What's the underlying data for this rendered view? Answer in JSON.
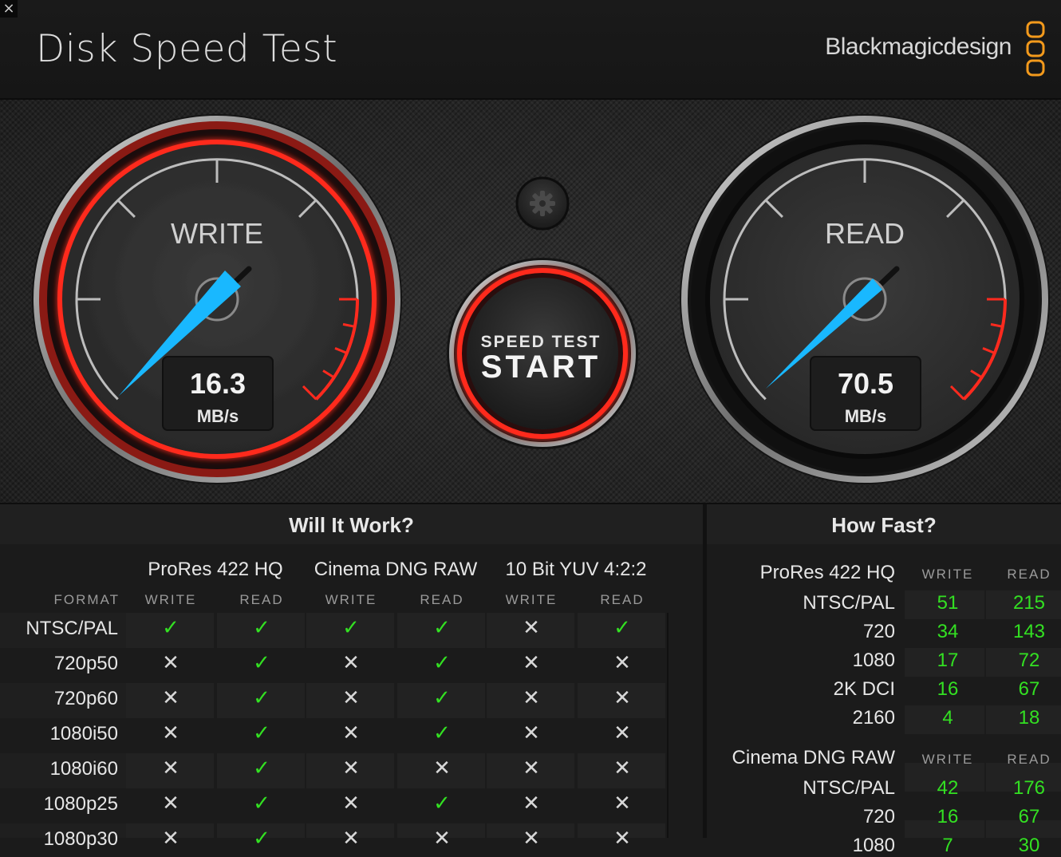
{
  "window": {
    "close_glyph": "×",
    "close_icon": "close-icon"
  },
  "header": {
    "title": "Disk Speed Test",
    "brand": "Blackmagicdesign"
  },
  "colors": {
    "accent_red": "#ff2a1e",
    "needle": "#19b8ff",
    "ok_green": "#33e022"
  },
  "gauges": {
    "write": {
      "label": "WRITE",
      "value": "16.3",
      "unit": "MB/s"
    },
    "read": {
      "label": "READ",
      "value": "70.5",
      "unit": "MB/s"
    }
  },
  "start_button": {
    "line1": "SPEED TEST",
    "line2": "START"
  },
  "settings_icon": "gear-icon",
  "will_it_work": {
    "title": "Will It Work?",
    "format_label": "FORMAT",
    "groups": [
      {
        "name": "ProRes 422 HQ",
        "write": "WRITE",
        "read": "READ"
      },
      {
        "name": "Cinema DNG RAW",
        "write": "WRITE",
        "read": "READ"
      },
      {
        "name": "10 Bit YUV 4:2:2",
        "write": "WRITE",
        "read": "READ"
      }
    ],
    "rows": [
      {
        "format": "NTSC/PAL",
        "cells": [
          "✓",
          "✓",
          "✓",
          "✓",
          "✕",
          "✓"
        ]
      },
      {
        "format": "720p50",
        "cells": [
          "✕",
          "✓",
          "✕",
          "✓",
          "✕",
          "✕"
        ]
      },
      {
        "format": "720p60",
        "cells": [
          "✕",
          "✓",
          "✕",
          "✓",
          "✕",
          "✕"
        ]
      },
      {
        "format": "1080i50",
        "cells": [
          "✕",
          "✓",
          "✕",
          "✓",
          "✕",
          "✕"
        ]
      },
      {
        "format": "1080i60",
        "cells": [
          "✕",
          "✓",
          "✕",
          "✕",
          "✕",
          "✕"
        ]
      },
      {
        "format": "1080p25",
        "cells": [
          "✕",
          "✓",
          "✕",
          "✓",
          "✕",
          "✕"
        ]
      },
      {
        "format": "1080p30",
        "cells": [
          "✕",
          "✓",
          "✕",
          "✕",
          "✕",
          "✕"
        ]
      }
    ]
  },
  "how_fast": {
    "title": "How Fast?",
    "sections": [
      {
        "name": "ProRes 422 HQ",
        "write": "WRITE",
        "read": "READ",
        "rows": [
          {
            "label": "NTSC/PAL",
            "write": "51",
            "read": "215"
          },
          {
            "label": "720",
            "write": "34",
            "read": "143"
          },
          {
            "label": "1080",
            "write": "17",
            "read": "72"
          },
          {
            "label": "2K DCI",
            "write": "16",
            "read": "67"
          },
          {
            "label": "2160",
            "write": "4",
            "read": "18"
          }
        ]
      },
      {
        "name": "Cinema DNG RAW",
        "write": "WRITE",
        "read": "READ",
        "rows": [
          {
            "label": "NTSC/PAL",
            "write": "42",
            "read": "176"
          },
          {
            "label": "720",
            "write": "16",
            "read": "67"
          },
          {
            "label": "1080",
            "write": "7",
            "read": "30"
          }
        ]
      }
    ]
  }
}
